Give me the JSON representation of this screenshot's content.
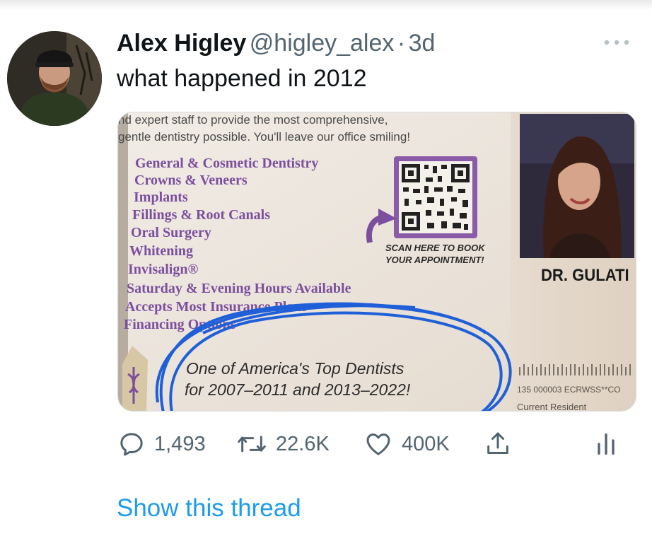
{
  "tweet": {
    "author_name": "Alex Higley",
    "author_handle": "@higley_alex",
    "separator": "·",
    "time": "3d",
    "text": "what happened in 2012"
  },
  "card": {
    "intro_line1": "nd expert staff to provide the most comprehensive,",
    "intro_line2": "gentle dentistry possible. You'll leave our office smiling!",
    "services": [
      "General & Cosmetic Dentistry",
      "Crowns & Veneers",
      "Implants",
      "Fillings & Root Canals",
      "Oral Surgery",
      "Whitening",
      "Invisalign®",
      "Saturday & Evening Hours Available",
      "Accepts Most Insurance Plans",
      "Financing Options"
    ],
    "scan_line1": "SCAN HERE TO BOOK",
    "scan_line2": "YOUR APPOINTMENT!",
    "doctor_name": "DR. GULATI",
    "top_line1": "One of America's Top Dentists",
    "top_line2": "for 2007–2011 and 2013–2022!",
    "mail_code": "135 000003 ECRWSS**CO",
    "resident": "Current Resident"
  },
  "actions": {
    "replies": "1,493",
    "retweets": "22.6K",
    "likes": "400K"
  },
  "icons": {
    "more": "more-horizontal-icon",
    "reply": "reply-icon",
    "retweet": "retweet-icon",
    "like": "heart-icon",
    "share": "share-icon",
    "analytics": "analytics-icon"
  },
  "colors": {
    "link_blue": "#1d9bf0",
    "muted": "#536471",
    "card_purple": "#7b4f9e",
    "circle_blue": "#1f5fd8"
  },
  "show_thread": "Show this thread"
}
